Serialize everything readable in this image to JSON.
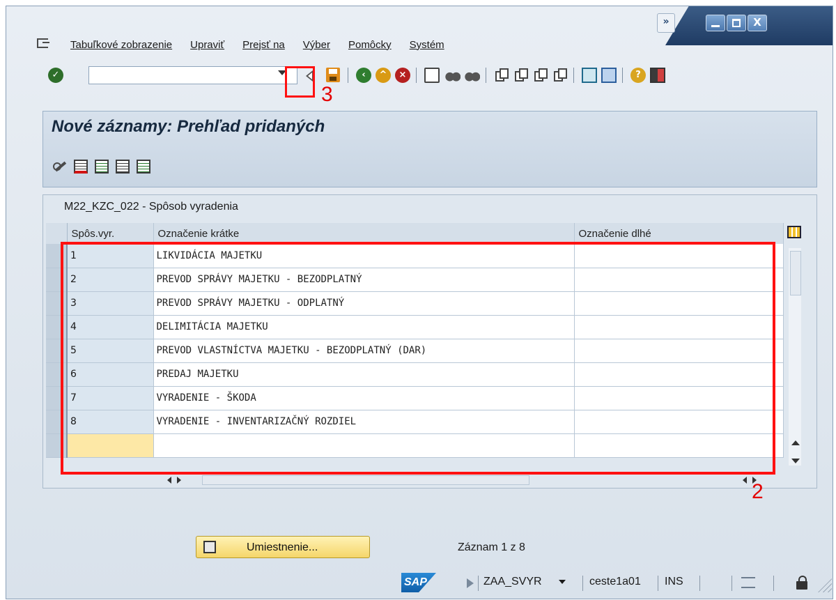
{
  "menu": {
    "items": [
      "Tabuľkové zobrazenie",
      "Upraviť",
      "Prejsť na",
      "Výber",
      "Pomôcky",
      "Systém"
    ]
  },
  "window": {
    "overflow": "»"
  },
  "toolbar": {
    "command_value": "",
    "icons": [
      "enter-icon",
      "back-icon",
      "save-icon",
      "green-back-icon",
      "exit-icon",
      "cancel-icon",
      "print-icon",
      "find-icon",
      "find-next-icon",
      "first-page-icon",
      "previous-page-icon",
      "next-page-icon",
      "last-page-icon",
      "create-session-icon",
      "shortcut-icon",
      "help-icon",
      "customize-layout-icon"
    ]
  },
  "annotations": {
    "save_marker": "3",
    "table_marker": "2",
    "marker_color": "#ff1111"
  },
  "page": {
    "title": "Nové záznamy: Prehľad pridaných"
  },
  "table": {
    "title": "M22_KZC_022  - Spôsob vyradenia",
    "columns": [
      "Spôs.vyr.",
      "Označenie krátke",
      "Označenie dlhé"
    ],
    "rows": [
      {
        "code": "1",
        "short": "LIKVIDÁCIA MAJETKU",
        "long": ""
      },
      {
        "code": "2",
        "short": "PREVOD SPRÁVY MAJETKU - BEZODPLATNÝ",
        "long": ""
      },
      {
        "code": "3",
        "short": "PREVOD SPRÁVY MAJETKU - ODPLATNÝ",
        "long": ""
      },
      {
        "code": "4",
        "short": "DELIMITÁCIA MAJETKU",
        "long": ""
      },
      {
        "code": "5",
        "short": "PREVOD VLASTNÍCTVA MAJETKU - BEZODPLATNÝ (DAR)",
        "long": ""
      },
      {
        "code": "6",
        "short": "PREDAJ MAJETKU",
        "long": ""
      },
      {
        "code": "7",
        "short": "VYRADENIE - ŠKODA",
        "long": ""
      },
      {
        "code": "8",
        "short": "VYRADENIE - INVENTARIZAČNÝ ROZDIEL",
        "long": ""
      },
      {
        "code": "",
        "short": "",
        "long": ""
      }
    ]
  },
  "footer": {
    "position_button": "Umiestnenie...",
    "record_status": "Záznam 1 z 8"
  },
  "statusbar": {
    "logo": "SAP",
    "system": "ZAA_SVYR",
    "host": "ceste1a01",
    "mode": "INS"
  }
}
